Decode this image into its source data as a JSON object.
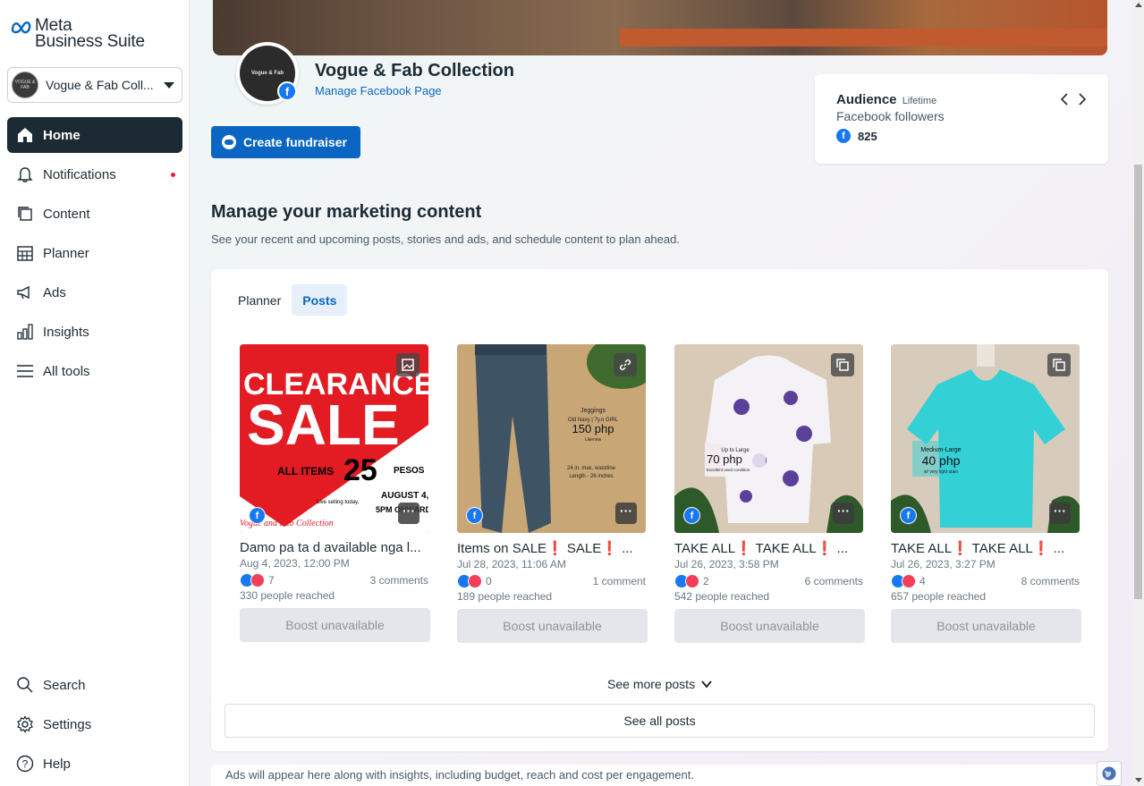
{
  "brand": {
    "line1": "Meta",
    "line2": "Business Suite"
  },
  "account": {
    "name": "Vogue & Fab Coll...",
    "avatar_text": "VOGUE & FAB"
  },
  "nav": {
    "items": [
      {
        "label": "Home",
        "icon": "home-icon"
      },
      {
        "label": "Notifications",
        "icon": "bell-icon"
      },
      {
        "label": "Content",
        "icon": "content-icon"
      },
      {
        "label": "Planner",
        "icon": "calendar-icon"
      },
      {
        "label": "Ads",
        "icon": "megaphone-icon"
      },
      {
        "label": "Insights",
        "icon": "bar-chart-icon"
      },
      {
        "label": "All tools",
        "icon": "menu-icon"
      }
    ],
    "bottom": [
      {
        "label": "Search",
        "icon": "search-icon"
      },
      {
        "label": "Settings",
        "icon": "gear-icon"
      },
      {
        "label": "Help",
        "icon": "help-icon"
      }
    ]
  },
  "page": {
    "name": "Vogue & Fab Collection",
    "manage_link": "Manage Facebook Page",
    "avatar_text": "Vogue & Fab"
  },
  "fundraiser": {
    "label": "Create fundraiser"
  },
  "audience": {
    "title": "Audience",
    "period": "Lifetime",
    "metric": "Facebook followers",
    "count": "825"
  },
  "marketing": {
    "title": "Manage your marketing content",
    "description": "See your recent and upcoming posts, stories and ads, and schedule content to plan ahead.",
    "tabs": [
      {
        "label": "Planner"
      },
      {
        "label": "Posts"
      }
    ]
  },
  "posts": [
    {
      "title": "Damo pa ta d available nga l...",
      "date": "Aug 4, 2023, 12:00 PM",
      "reactions": "7",
      "comments": "3 comments",
      "reach": "330 people reached",
      "boost": "Boost unavailable",
      "thumb_text": [
        "CLEARANCE",
        "SALE",
        "ALL ITEMS",
        "25",
        "PESOS",
        "AUGUST 4,",
        "5PM ONWARDS",
        "Live selling today,",
        "Vogue and Fab Collection"
      ],
      "type_icon": "photo-icon"
    },
    {
      "title": "Items on SALE❗ SALE❗ ...",
      "date": "Jul 28, 2023, 11:06 AM",
      "reactions": "0",
      "comments": "1 comment",
      "reach": "189 people reached",
      "boost": "Boost unavailable",
      "thumb_text": [
        "Jeggings",
        "Old Navy | 7y.o GIRL",
        "150 php",
        "Likenew",
        "24 in. max. waistline",
        "Length - 26 inches"
      ],
      "type_icon": "link-icon"
    },
    {
      "title": "TAKE ALL❗ TAKE ALL❗ ...",
      "date": "Jul 26, 2023, 3:58 PM",
      "reactions": "2",
      "comments": "6 comments",
      "reach": "542 people reached",
      "boost": "Boost unavailable",
      "thumb_text": [
        "Up to Large",
        "70 php",
        "Excellent used condition"
      ],
      "type_icon": "carousel-icon"
    },
    {
      "title": "TAKE ALL❗ TAKE ALL❗ ...",
      "date": "Jul 26, 2023, 3:27 PM",
      "reactions": "4",
      "comments": "8 comments",
      "reach": "657 people reached",
      "boost": "Boost unavailable",
      "thumb_text": [
        "Medium-Large",
        "40 php",
        "w/ very light stain"
      ],
      "type_icon": "carousel-icon"
    }
  ],
  "see_more": "See more posts",
  "see_all": "See all posts",
  "ads_note": "Ads will appear here along with insights, including budget, reach and cost per engagement.",
  "colors": {
    "accent": "#0a66c2",
    "nav_active": "#1c2b33",
    "facebook": "#1877f2",
    "notification_dot": "#e41e3f"
  }
}
